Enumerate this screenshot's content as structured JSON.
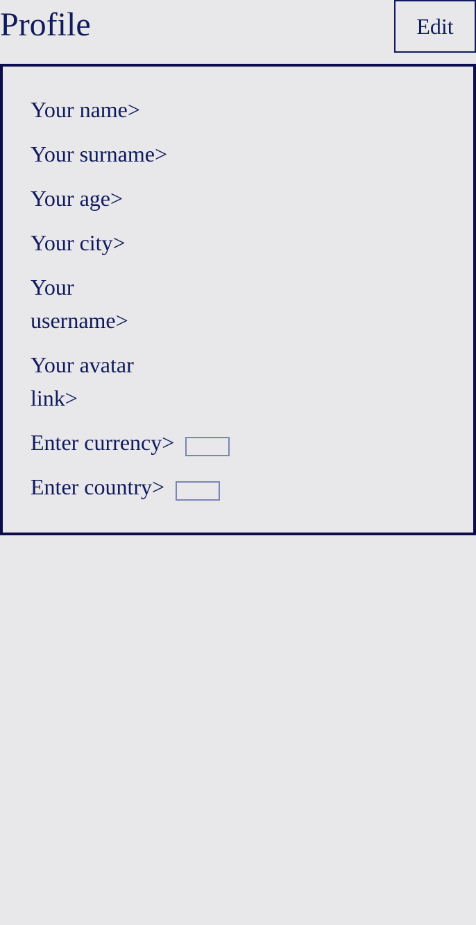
{
  "header": {
    "title": "Profile",
    "edit_label": "Edit"
  },
  "profile": {
    "name_label": "Your name>",
    "surname_label": "Your surname>",
    "age_label": "Your age>",
    "city_label": "Your city>",
    "username_label": "Your username>",
    "avatar_label": "Your avatar link>",
    "currency_label": "Enter currency>",
    "currency_value": "",
    "country_label": "Enter country>",
    "country_value": ""
  }
}
